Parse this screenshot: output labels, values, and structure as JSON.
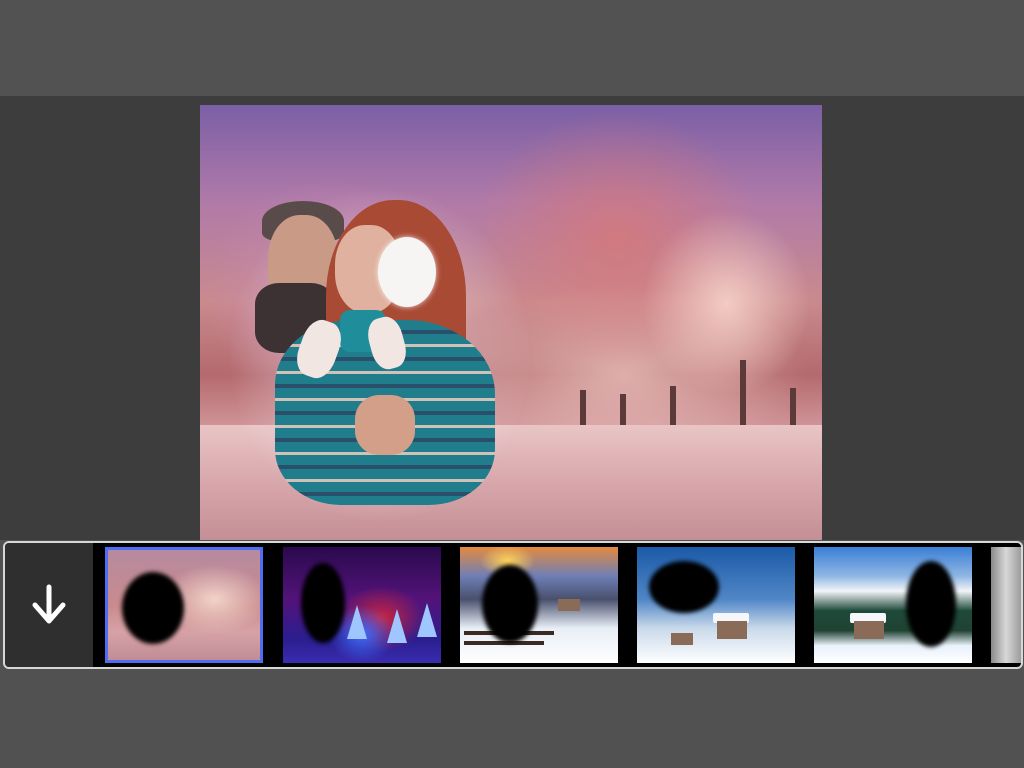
{
  "app": {
    "colors": {
      "background": "#515151",
      "workspace": "#3d3d3d",
      "selection_border": "#4f6df0",
      "strip_border": "#d8d8d8"
    }
  },
  "editor": {
    "canvas_photo": "couple-in-winter-forest-frame"
  },
  "frame_strip": {
    "download_icon": "download-arrow-icon",
    "selected_index": 0,
    "frames": [
      {
        "name": "pink-snowy-forest"
      },
      {
        "name": "night-christmas-trees"
      },
      {
        "name": "sunset-snow-fence"
      },
      {
        "name": "snowfall-cabins"
      },
      {
        "name": "mountain-cabin"
      },
      {
        "name": "snowy-birch-forest"
      }
    ]
  }
}
